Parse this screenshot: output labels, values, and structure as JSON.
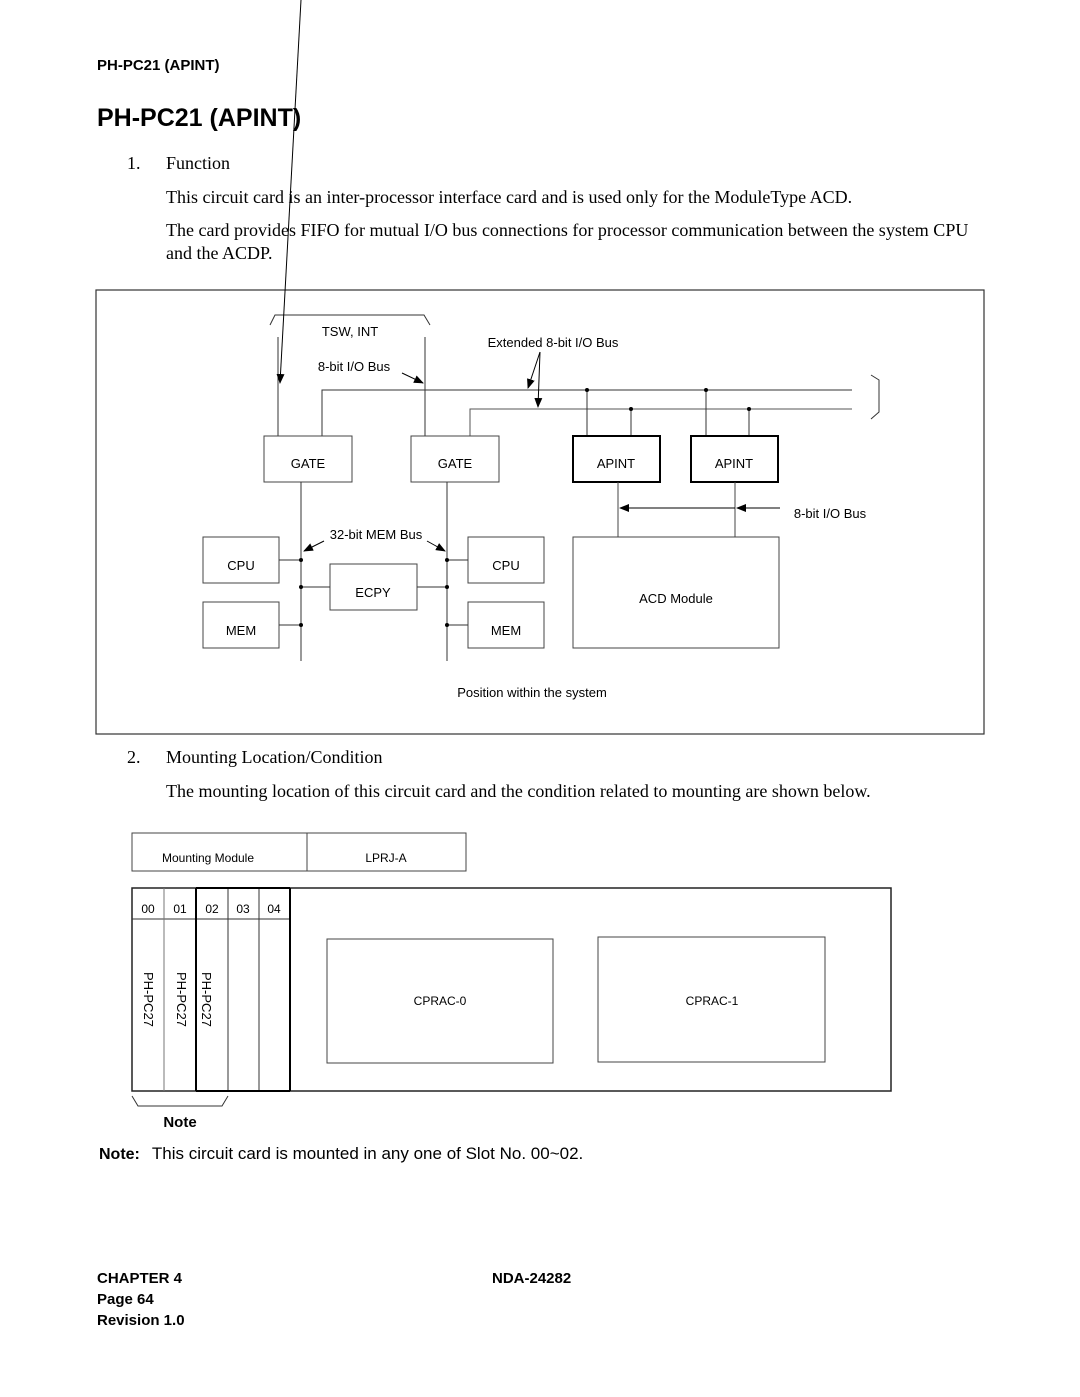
{
  "header": {
    "running_title": "PH-PC21 (APINT)",
    "page_title": "PH-PC21 (APINT)"
  },
  "section1": {
    "number": "1.",
    "title": "Function",
    "paragraphs": [
      "This circuit card is an inter-processor interface card and is used only for the ModuleType ACD.",
      "The card provides FIFO for mutual I/O bus connections for processor communication between the system CPU and the ACDP."
    ]
  },
  "diagram1": {
    "caption": "Position within the system",
    "labels": {
      "tsw_int": "TSW, INT",
      "io_bus_left": "8-bit I/O Bus",
      "extended_bus": "Extended 8-bit I/O Bus",
      "io_bus_right": "8-bit I/O Bus",
      "mem_bus": "32-bit MEM Bus"
    },
    "blocks": {
      "gate_1": "GATE",
      "gate_2": "GATE",
      "apint_1": "APINT",
      "apint_2": "APINT",
      "cpu_1": "CPU",
      "cpu_2": "CPU",
      "mem_1": "MEM",
      "mem_2": "MEM",
      "ecpy": "ECPY",
      "acd_module": "ACD Module"
    }
  },
  "section2": {
    "number": "2.",
    "title": "Mounting Location/Condition",
    "paragraphs": [
      "The mounting location of this circuit card and the condition related to mounting are shown below."
    ]
  },
  "diagram2": {
    "mounting_module_label": "Mounting Module",
    "mounting_module_value": "LPRJ-A",
    "slots": [
      "00",
      "01",
      "02",
      "03",
      "04"
    ],
    "slot_cards": [
      "PH-PC27",
      "PH-PC27",
      "PH-PC27",
      "",
      ""
    ],
    "cprac_0": "CPRAC-0",
    "cprac_1": "CPRAC-1",
    "bracket_label": "Note"
  },
  "note": {
    "label": "Note:",
    "text": "This circuit card is mounted in any one of Slot No. 00~02."
  },
  "footer": {
    "chapter": "CHAPTER 4",
    "page": "Page 64",
    "revision": "Revision 1.0",
    "doc_number": "NDA-24282"
  }
}
